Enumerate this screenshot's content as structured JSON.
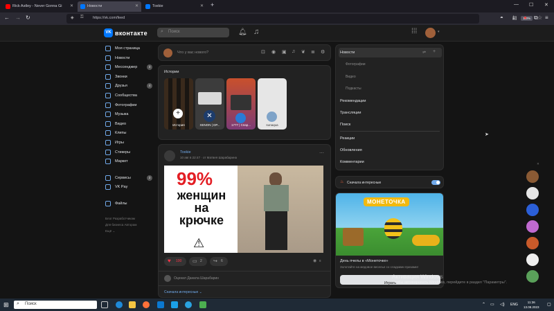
{
  "browser": {
    "tabs": [
      {
        "title": "Rick Astley - Never Gonna Gi"
      },
      {
        "title": "Новости"
      },
      {
        "title": "Toxkie"
      }
    ],
    "new_tab": "+",
    "url": "https://vk.com/feed",
    "zoom": "110%"
  },
  "vk": {
    "logo": "вконтакте",
    "search_placeholder": "Поиск",
    "left_menu": [
      {
        "label": "Моя страница",
        "badge": ""
      },
      {
        "label": "Новости",
        "badge": ""
      },
      {
        "label": "Мессенджер",
        "badge": "3"
      },
      {
        "label": "Звонки",
        "badge": ""
      },
      {
        "label": "Друзья",
        "badge": "4"
      },
      {
        "label": "Сообщества",
        "badge": ""
      },
      {
        "label": "Фотографии",
        "badge": ""
      },
      {
        "label": "Музыка",
        "badge": ""
      },
      {
        "label": "Видео",
        "badge": ""
      },
      {
        "label": "Клипы",
        "badge": ""
      },
      {
        "label": "Игры",
        "badge": ""
      },
      {
        "label": "Стикеры",
        "badge": ""
      },
      {
        "label": "Маркет",
        "badge": ""
      }
    ],
    "left_menu2": [
      {
        "label": "Сервисы",
        "badge": "3"
      },
      {
        "label": "VK Pay",
        "badge": ""
      }
    ],
    "left_menu3": [
      {
        "label": "Файлы"
      }
    ],
    "footer": {
      "l1": "Блог    Разработчикам",
      "l2": "Для бизнеса    Авторам",
      "l3": "Ещё ⌄"
    },
    "composer_placeholder": "Что у вас нового?",
    "stories": {
      "title": "Истории",
      "items": [
        {
          "caption": "История"
        },
        {
          "caption": "XENON | DP..."
        },
        {
          "caption": "1777 | Спар..."
        },
        {
          "caption": "sunaqua"
        }
      ]
    },
    "post": {
      "author": "Toxkie",
      "meta": "10 авг в 22:47  · от Матвея Шарабарина",
      "image_big": "99%",
      "image_text": "женщин\nна\nкрючке",
      "likes": "100",
      "comments": "2",
      "shares": "6",
      "views": "8",
      "comment_preview": "Оценил Данила Шарабарин",
      "show_interesting": "Сначала интересные ⌄"
    },
    "right_menu": {
      "items_main": [
        {
          "label": "Новости"
        },
        {
          "label": "Фотографии",
          "sub": true
        },
        {
          "label": "Видео",
          "sub": true
        },
        {
          "label": "Подкасты",
          "sub": true
        },
        {
          "label": "Рекомендации"
        },
        {
          "label": "Трансляции"
        },
        {
          "label": "Поиск"
        }
      ],
      "items_more": [
        {
          "label": "Реакции"
        },
        {
          "label": "Обновления"
        },
        {
          "label": "Комментарии"
        }
      ],
      "toggle_label": "Сначала интересные"
    },
    "promo": {
      "brand": "МОНЕТОЧКА",
      "title": "День пчелы в «Монеточке»",
      "desc": "Золотайте на медовое веселье со сладкими призами!",
      "button": "Играть"
    }
  },
  "windows": {
    "activation_title": "Активация Windows",
    "activation_text": "Чтобы активировать Windows, перейдите в раздел \"Параметры\".",
    "search": "Поиск",
    "lang": "ENG",
    "time": "11:36",
    "date": "13.08.2023"
  }
}
